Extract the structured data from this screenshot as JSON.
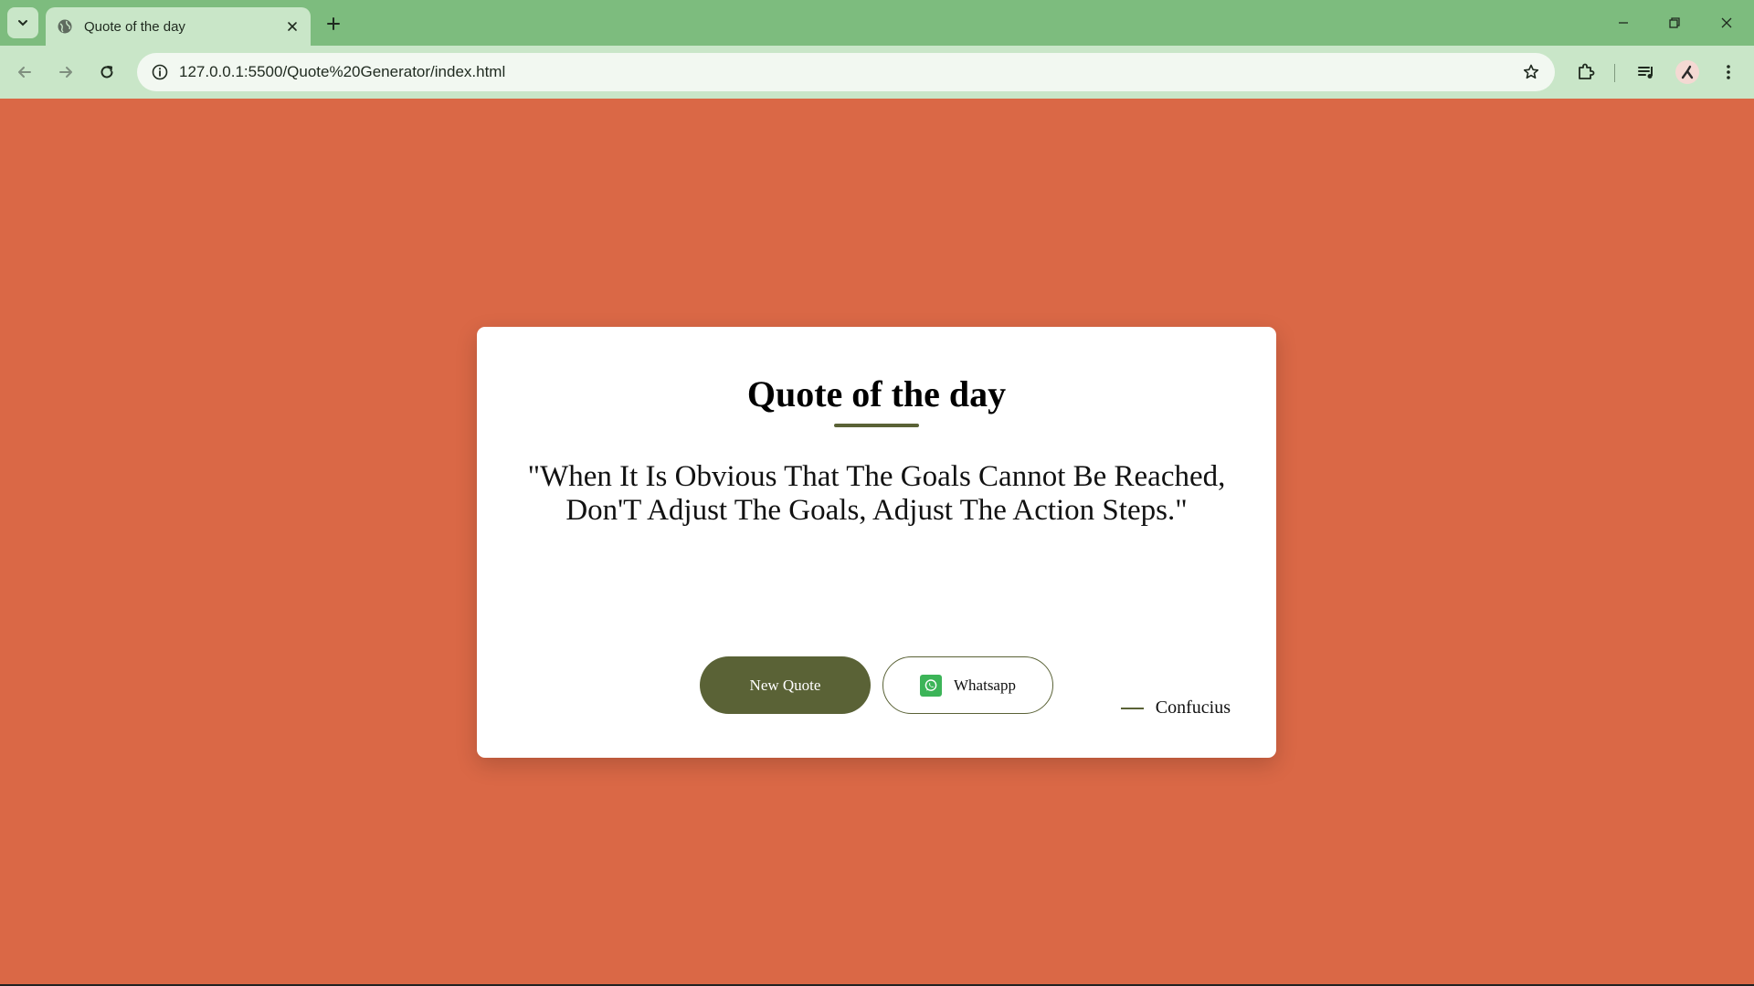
{
  "browser": {
    "tab_title": "Quote of the day",
    "url": "127.0.0.1:5500/Quote%20Generator/index.html"
  },
  "page": {
    "background_color": "#da6846",
    "card": {
      "title": "Quote of the day",
      "quote": "\"When It Is Obvious That The Goals Cannot Be Reached, Don'T Adjust The Goals, Adjust The Action Steps.\"",
      "author": "Confucius",
      "new_quote_label": "New Quote",
      "whatsapp_label": "Whatsapp",
      "accent_color": "#5a6236"
    }
  },
  "icons": {
    "tab_search": "chevron-down-icon",
    "favicon": "globe-icon",
    "tab_close": "close-icon",
    "new_tab": "plus-icon",
    "minimize": "minimize-icon",
    "maximize": "restore-icon",
    "close_window": "close-icon",
    "back": "arrow-left-icon",
    "forward": "arrow-right-icon",
    "reload": "reload-icon",
    "site_info": "info-icon",
    "bookmark": "star-icon",
    "extensions": "puzzle-icon",
    "media": "media-control-icon",
    "profile": "avatar",
    "menu": "more-vertical-icon",
    "whatsapp": "whatsapp-icon"
  }
}
